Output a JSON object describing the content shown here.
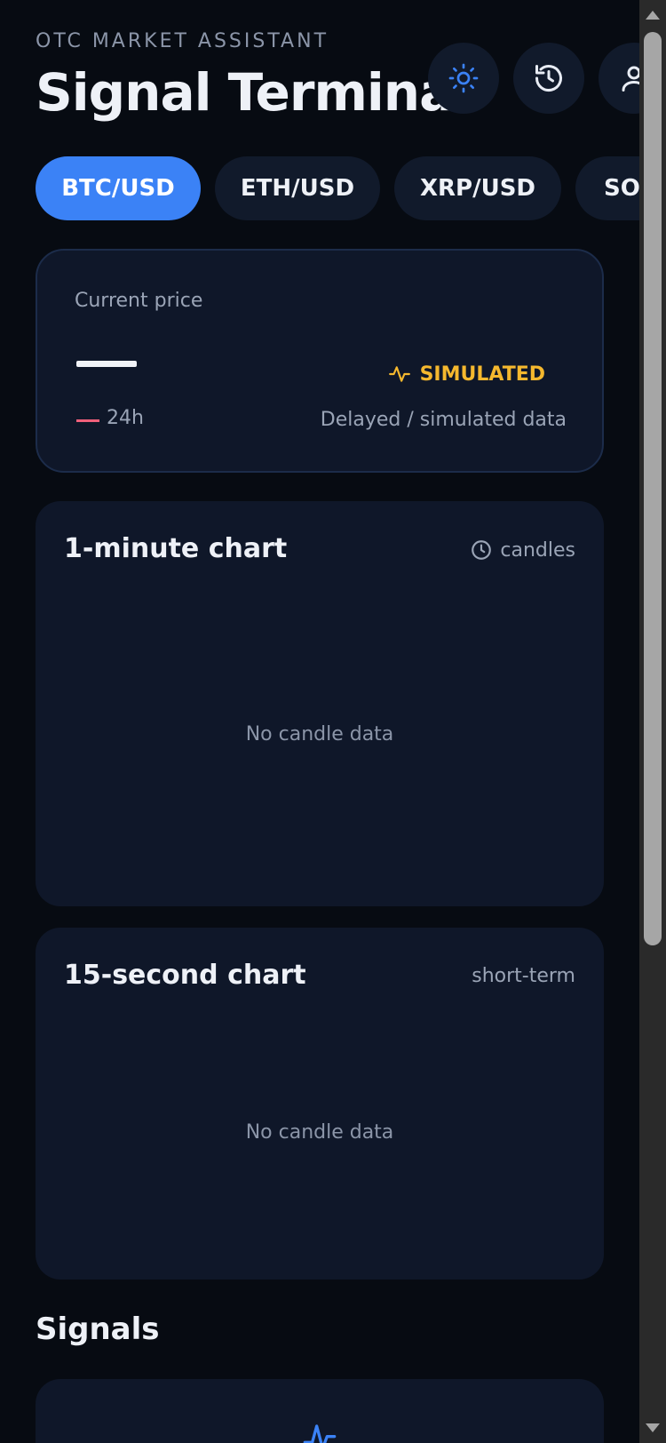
{
  "header": {
    "eyebrow": "OTC MARKET ASSISTANT",
    "title": "Signal Terminal",
    "icons": [
      "sun-icon",
      "history-icon",
      "user-icon"
    ]
  },
  "pairs": [
    {
      "label": "BTC/USD",
      "active": true
    },
    {
      "label": "ETH/USD",
      "active": false
    },
    {
      "label": "XRP/USD",
      "active": false
    },
    {
      "label": "SOL",
      "active": false
    }
  ],
  "price_card": {
    "label": "Current price",
    "change_label": "24h",
    "status": "SIMULATED",
    "status_sub": "Delayed / simulated data"
  },
  "chart_1m": {
    "title": "1-minute chart",
    "meta": "candles",
    "empty": "No candle data"
  },
  "chart_15s": {
    "title": "15-second chart",
    "meta": "short-term",
    "empty": "No candle data"
  },
  "signals": {
    "title": "Signals"
  },
  "colors": {
    "background": "#070b12",
    "card": "#0f1729",
    "accent": "#3b82f6",
    "warning": "#f5b82e",
    "negative": "#f0607a"
  }
}
